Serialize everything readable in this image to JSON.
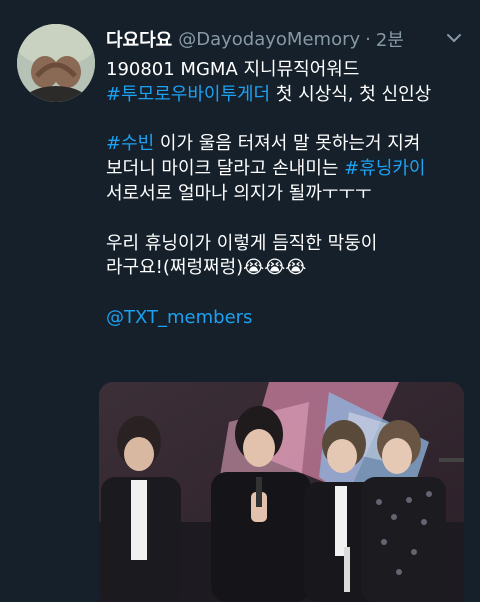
{
  "tweet": {
    "display_name": "다요다요",
    "handle": "@DayodayoMemory",
    "separator": "·",
    "time": "2분",
    "lines": [
      {
        "parts": [
          {
            "text": "190801 MGMA 지니뮤직어워드"
          }
        ]
      },
      {
        "parts": [
          {
            "text": "#투모로우바이투게더",
            "link": true
          },
          {
            "text": " 첫 시상식, 첫 신인상"
          }
        ]
      },
      {
        "blank": true
      },
      {
        "parts": [
          {
            "text": "#수빈",
            "link": true
          },
          {
            "text": " 이가 울음 터져서 말 못하는거 지켜"
          }
        ]
      },
      {
        "parts": [
          {
            "text": "보더니 마이크 달라고 손내미는 "
          },
          {
            "text": "#휴닝카이",
            "link": true
          }
        ]
      },
      {
        "parts": [
          {
            "text": "서로서로 얼마나 의지가 될까ㅜㅜㅜ"
          }
        ]
      },
      {
        "blank": true
      },
      {
        "parts": [
          {
            "text": "우리 휴닝이가 이렇게 듬직한 막둥이"
          }
        ]
      },
      {
        "parts": [
          {
            "text": "라구요!(쩌렁쩌렁)😭😭😭"
          }
        ]
      },
      {
        "blank": true
      },
      {
        "parts": [
          {
            "text": "@TXT_members",
            "link": true
          }
        ]
      }
    ],
    "menu_icon": "chevron-down-icon",
    "media": "photo of four performers on an awards stage, one holding a microphone"
  },
  "colors": {
    "background": "#15202b",
    "text": "#ffffff",
    "secondary": "#8899a6",
    "link": "#1da1f2"
  }
}
